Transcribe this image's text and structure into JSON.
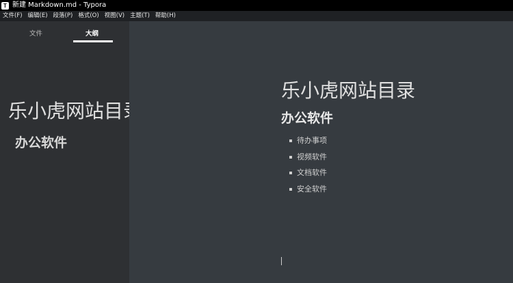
{
  "window": {
    "app_icon": "T",
    "title": "新建 Markdown.md - Typora"
  },
  "menu": [
    "文件(F)",
    "编辑(E)",
    "段落(P)",
    "格式(O)",
    "视图(V)",
    "主题(T)",
    "帮助(H)"
  ],
  "sidebar": {
    "tabs": {
      "files": "文件",
      "outline": "大纲"
    },
    "outline": {
      "h1": "乐小虎网站目录",
      "h2": "办公软件"
    }
  },
  "document": {
    "h1": "乐小虎网站目录",
    "h2": "办公软件",
    "list": [
      "待办事项",
      "视频软件",
      "文档软件",
      "安全软件"
    ]
  }
}
